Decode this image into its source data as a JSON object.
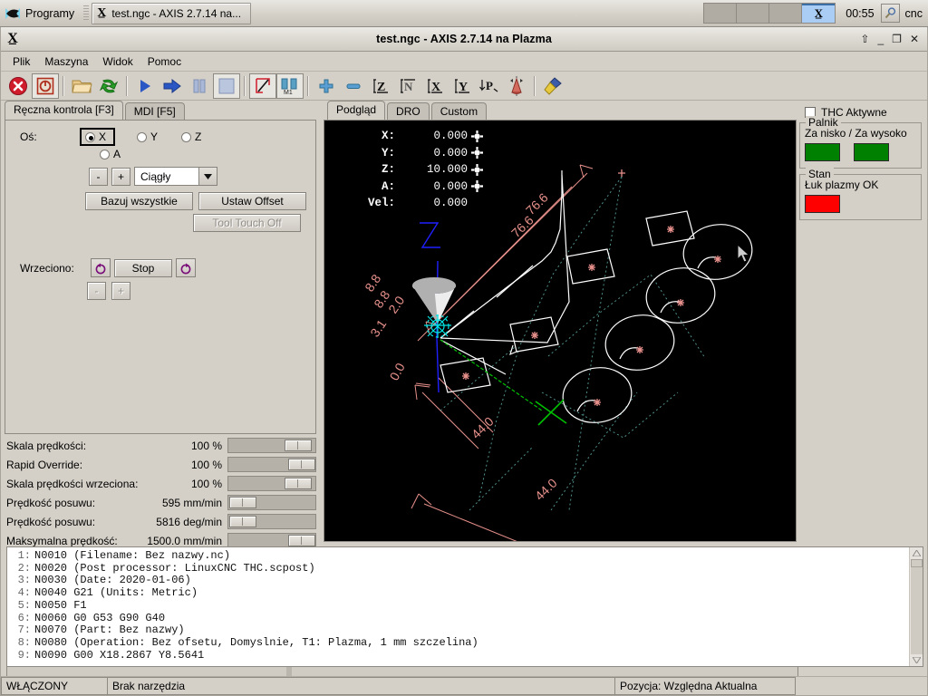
{
  "taskbar": {
    "start_label": "Programy",
    "task_title": "test.ngc - AXIS 2.7.14 na...",
    "clock": "00:55",
    "host": "cnc",
    "x_icon": "x-window-icon",
    "search_icon": "magnifier-icon"
  },
  "window": {
    "title": "test.ngc - AXIS 2.7.14 na Plazma",
    "btn_shade": "⇧",
    "btn_minimize": "_",
    "btn_maximize": "❐",
    "btn_close": "✕"
  },
  "menu": {
    "items": [
      {
        "label": "Plik",
        "accel_index": -1
      },
      {
        "label": "Maszyna",
        "accel_index": 1
      },
      {
        "label": "Widok",
        "accel_index": -1
      },
      {
        "label": "Pomoc",
        "accel_index": -1
      }
    ]
  },
  "toolbar": {
    "items": [
      {
        "name": "estop-button",
        "tip": "E-Stop"
      },
      {
        "name": "power-button",
        "tip": "Power On"
      },
      {
        "name": "open-file-button",
        "tip": "Otwórz"
      },
      {
        "name": "reload-file-button",
        "tip": "Przeładuj"
      },
      {
        "name": "run-program-button",
        "tip": "Start"
      },
      {
        "name": "step-program-button",
        "tip": "Krok"
      },
      {
        "name": "pause-program-button",
        "tip": "Pauza"
      },
      {
        "name": "stop-program-button",
        "tip": "Stop"
      },
      {
        "name": "toggle-block-delete-button",
        "tip": "Blok delete"
      },
      {
        "name": "toggle-optional-stop-button",
        "tip": "M1 opcjonalny stop"
      },
      {
        "name": "zoom-in-button",
        "tip": "Powiększ"
      },
      {
        "name": "zoom-out-button",
        "tip": "Pomniejsz"
      },
      {
        "name": "view-z-button",
        "tip": "Widok Z"
      },
      {
        "name": "view-z2-button",
        "tip": "Widok Z2"
      },
      {
        "name": "view-x-button",
        "tip": "Widok X"
      },
      {
        "name": "view-y-button",
        "tip": "Widok Y"
      },
      {
        "name": "view-p-button",
        "tip": "Widok P"
      },
      {
        "name": "toggle-cone-button",
        "tip": "Pokaż narzędzie"
      },
      {
        "name": "clear-plot-button",
        "tip": "Wyczyść"
      }
    ]
  },
  "left_panel": {
    "tabs": [
      {
        "label": "Ręczna kontrola [F3]",
        "active": true
      },
      {
        "label": "MDI [F5]",
        "active": false
      }
    ],
    "axis_label": "Oś:",
    "axes": [
      {
        "label": "X",
        "selected": true
      },
      {
        "label": "Y",
        "selected": false
      },
      {
        "label": "Z",
        "selected": false
      },
      {
        "label": "A",
        "selected": false
      }
    ],
    "jog_minus": "-",
    "jog_plus": "+",
    "jog_mode": "Ciągły",
    "home_all": "Bazuj wszystkie",
    "set_offset": "Ustaw Offset",
    "tool_touch_off": "Tool Touch Off",
    "spindle_label": "Wrzeciono:",
    "spindle_stop": "Stop",
    "spindle_ccw_icon": "spindle-ccw-icon",
    "spindle_cw_icon": "spindle-cw-icon",
    "spindle_minus": "-",
    "spindle_plus": "+"
  },
  "sliders": [
    {
      "name": "Skala prędkości:",
      "value": "100 %",
      "pos": 62
    },
    {
      "name": "Rapid Override:",
      "value": "100 %",
      "pos": 66
    },
    {
      "name": "Skala prędkości wrzeciona:",
      "value": "100 %",
      "pos": 62
    },
    {
      "name": "Prędkość posuwu:",
      "value": "595 mm/min",
      "pos": 1
    },
    {
      "name": "Prędkość posuwu:",
      "value": "5816 deg/min",
      "pos": 1
    },
    {
      "name": "Maksymalna prędkość:",
      "value": "1500.0 mm/min",
      "pos": 66
    }
  ],
  "center_panel": {
    "tabs": [
      {
        "label": "Podgląd",
        "active": true
      },
      {
        "label": "DRO",
        "active": false
      },
      {
        "label": "Custom",
        "active": false
      }
    ],
    "dro": [
      {
        "key": "X:",
        "value": "0.000",
        "has_icon": true
      },
      {
        "key": "Y:",
        "value": "0.000",
        "has_icon": true
      },
      {
        "key": "Z:",
        "value": "10.000",
        "has_icon": true
      },
      {
        "key": "A:",
        "value": "0.000",
        "has_icon": true
      },
      {
        "key": "Vel:",
        "value": "0.000",
        "has_icon": false
      }
    ],
    "dimension_labels": [
      "76.6",
      "76.6",
      "8.8",
      "8.8",
      "2.0",
      "3.1",
      "0.0",
      "44.0",
      "44.0"
    ],
    "colors": {
      "background": "#000000",
      "toolpath": "#ffffff",
      "dimension": "#e8918c",
      "rapid": "#4f8f8a",
      "feed_green": "#00c000",
      "axis_blue": "#2020ff",
      "cone": "#b0b0b0",
      "marker": "#00e5e5"
    }
  },
  "right_panel": {
    "thc_checkbox_label": "THC Aktywne",
    "thc_checked": false,
    "torch_group_title": "Palnik",
    "torch_text": "Za nisko / Za wysoko",
    "torch_led_left_color": "#008000",
    "torch_led_right_color": "#008000",
    "state_group_title": "Stan",
    "state_text": "Łuk plazmy OK",
    "state_led_color": "#ff0000"
  },
  "gcode": {
    "lines": [
      {
        "n": "1:",
        "text": "N0010 (Filename: Bez nazwy.nc)"
      },
      {
        "n": "2:",
        "text": "N0020 (Post processor: LinuxCNC THC.scpost)"
      },
      {
        "n": "3:",
        "text": "N0030 (Date: 2020-01-06)"
      },
      {
        "n": "4:",
        "text": "N0040 G21 (Units: Metric)"
      },
      {
        "n": "5:",
        "text": "N0050 F1"
      },
      {
        "n": "6:",
        "text": "N0060 G0 G53 G90 G40"
      },
      {
        "n": "7:",
        "text": "N0070 (Part: Bez nazwy)"
      },
      {
        "n": "8:",
        "text": "N0080 (Operation: Bez ofsetu, Domyslnie, T1: Plazma, 1 mm szczelina)"
      },
      {
        "n": "9:",
        "text": "N0090 G00 X18.2867 Y8.5641"
      }
    ]
  },
  "statusbar": {
    "machine_state": "WŁĄCZONY",
    "tool": "Brak narzędzia",
    "position": "Pozycja: Względna Aktualna"
  }
}
